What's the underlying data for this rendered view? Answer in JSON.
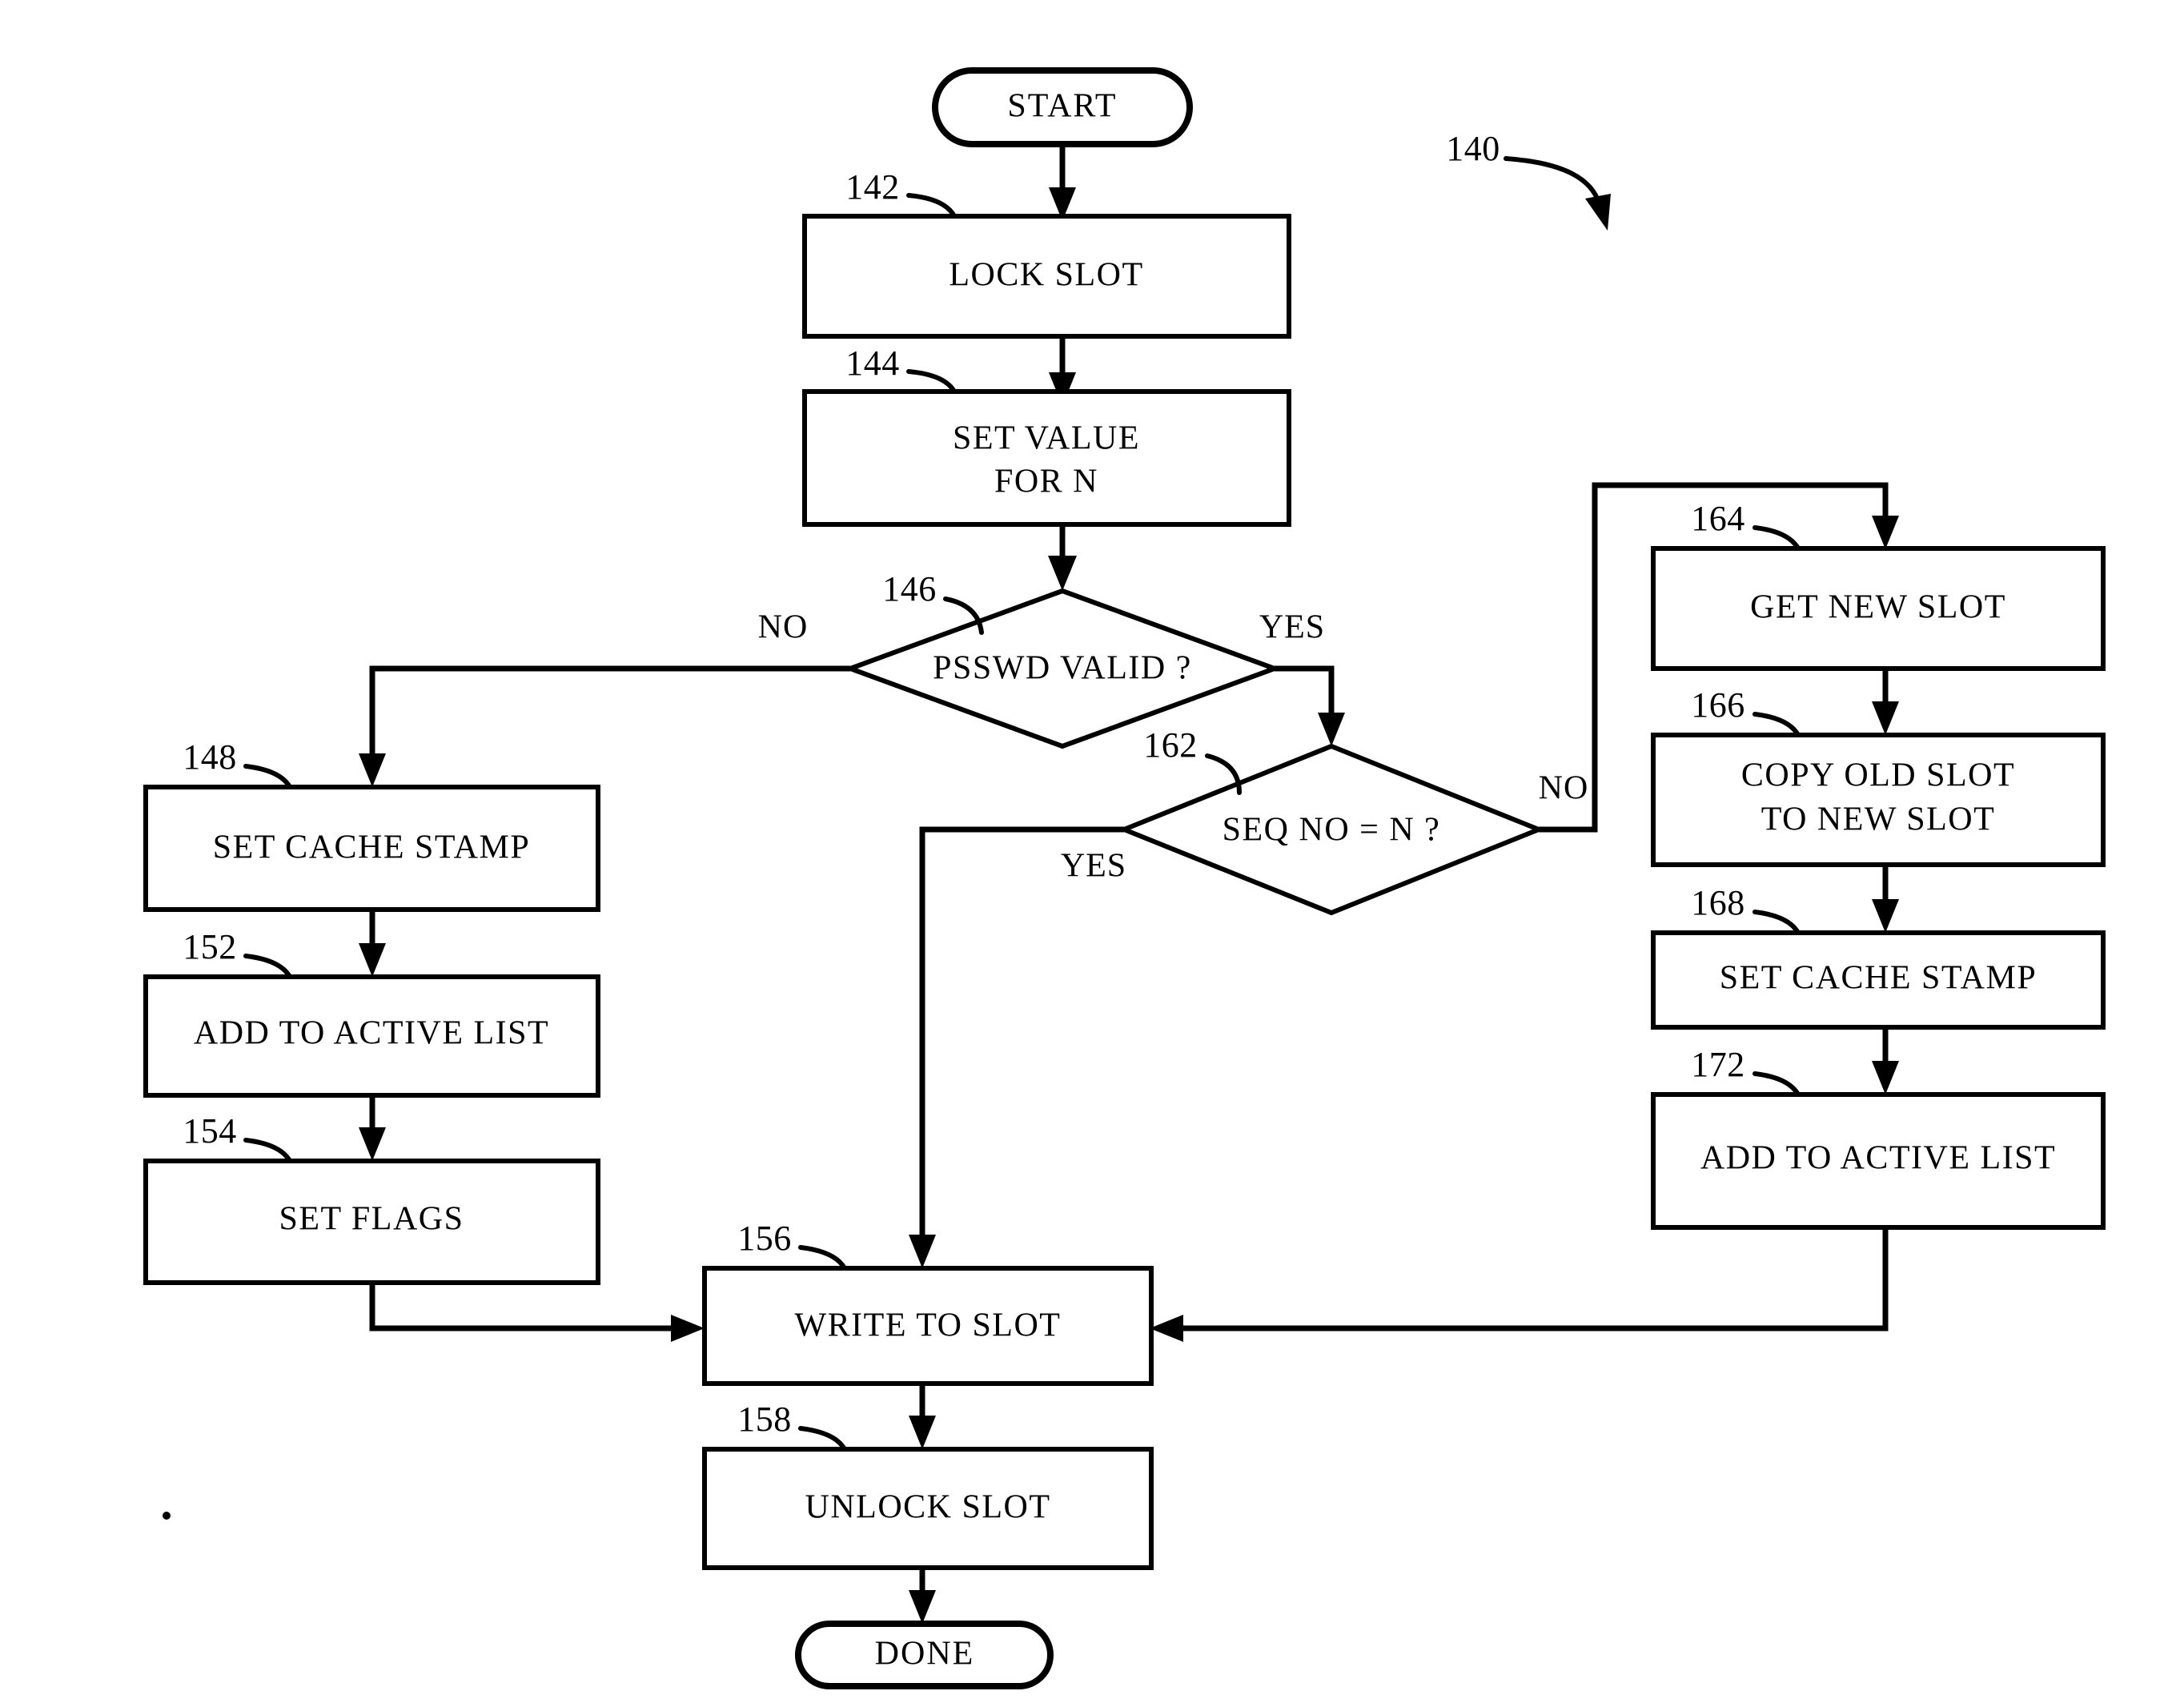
{
  "figure": {
    "number": "140",
    "type": "flowchart",
    "description": "Patent flowchart for slot write procedure with password and sequence number validation"
  },
  "nodes": {
    "start": {
      "label": "START",
      "shape": "terminator"
    },
    "lock_slot": {
      "label": "LOCK SLOT",
      "ref": "142",
      "shape": "process"
    },
    "set_value_for_n": {
      "label_line1": "SET VALUE",
      "label_line2": "FOR N",
      "ref": "144",
      "shape": "process"
    },
    "psswd_valid": {
      "label": "PSSWD VALID ?",
      "ref": "146",
      "shape": "decision"
    },
    "seq_no_eq_n": {
      "label": "SEQ NO = N ?",
      "ref": "162",
      "shape": "decision"
    },
    "set_cache_stamp_left": {
      "label": "SET CACHE STAMP",
      "ref": "148",
      "shape": "process"
    },
    "add_to_active_list_left": {
      "label": "ADD TO ACTIVE LIST",
      "ref": "152",
      "shape": "process"
    },
    "set_flags": {
      "label": "SET FLAGS",
      "ref": "154",
      "shape": "process"
    },
    "get_new_slot": {
      "label": "GET NEW SLOT",
      "ref": "164",
      "shape": "process"
    },
    "copy_old_slot": {
      "label_line1": "COPY OLD SLOT",
      "label_line2": "TO NEW SLOT",
      "ref": "166",
      "shape": "process"
    },
    "set_cache_stamp_right": {
      "label": "SET CACHE STAMP",
      "ref": "168",
      "shape": "process"
    },
    "add_to_active_list_right": {
      "label": "ADD TO ACTIVE LIST",
      "ref": "172",
      "shape": "process"
    },
    "write_to_slot": {
      "label": "WRITE TO SLOT",
      "ref": "156",
      "shape": "process"
    },
    "unlock_slot": {
      "label": "UNLOCK SLOT",
      "ref": "158",
      "shape": "process"
    },
    "done": {
      "label": "DONE",
      "shape": "terminator"
    }
  },
  "branch_labels": {
    "psswd_no": "NO",
    "psswd_yes": "YES",
    "seq_yes": "YES",
    "seq_no": "NO"
  },
  "colors": {
    "stroke": "#000000",
    "fill": "#ffffff",
    "background": "#ffffff"
  }
}
